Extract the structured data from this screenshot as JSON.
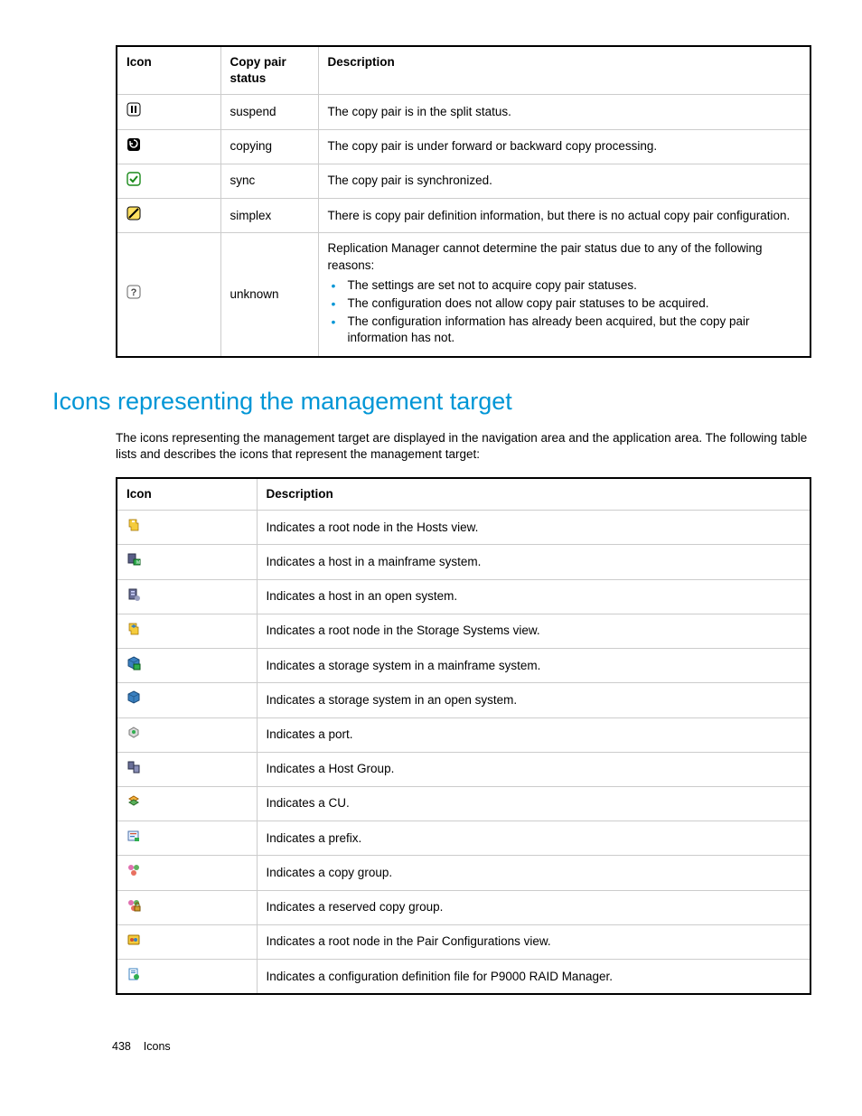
{
  "table1": {
    "headers": [
      "Icon",
      "Copy pair status",
      "Description"
    ],
    "rows": [
      {
        "status": "suspend",
        "desc": "The copy pair is in the split status."
      },
      {
        "status": "copying",
        "desc": "The copy pair is under forward or backward copy processing."
      },
      {
        "status": "sync",
        "desc": "The copy pair is synchronized."
      },
      {
        "status": "simplex",
        "desc": "There is copy pair definition information, but there is no actual copy pair configuration."
      },
      {
        "status": "unknown",
        "desc_intro": "Replication Manager cannot determine the pair status due to any of the following reasons:",
        "desc_items": [
          "The settings are set not to acquire copy pair statuses.",
          "The configuration does not allow copy pair statuses to be acquired.",
          "The configuration information has already been acquired, but the copy pair information has not."
        ]
      }
    ]
  },
  "heading": "Icons representing the management target",
  "intro": "The icons representing the management target are displayed in the navigation area and the application area. The following table lists and describes the icons that represent the management target:",
  "table2": {
    "headers": [
      "Icon",
      "Description"
    ],
    "rows": [
      {
        "desc": "Indicates a root node in the Hosts view."
      },
      {
        "desc": "Indicates a host in a mainframe system."
      },
      {
        "desc": "Indicates a host in an open system."
      },
      {
        "desc": "Indicates a root node in the Storage Systems view."
      },
      {
        "desc": "Indicates a storage system in a mainframe system."
      },
      {
        "desc": "Indicates a storage system in an open system."
      },
      {
        "desc": "Indicates a port."
      },
      {
        "desc": "Indicates a Host Group."
      },
      {
        "desc": "Indicates a CU."
      },
      {
        "desc": "Indicates a prefix."
      },
      {
        "desc": "Indicates a copy group."
      },
      {
        "desc": "Indicates a reserved copy group."
      },
      {
        "desc": "Indicates a root node in the Pair Configurations view."
      },
      {
        "desc": "Indicates a configuration definition file for P9000 RAID Manager."
      }
    ]
  },
  "footer": {
    "page": "438",
    "section": "Icons"
  }
}
